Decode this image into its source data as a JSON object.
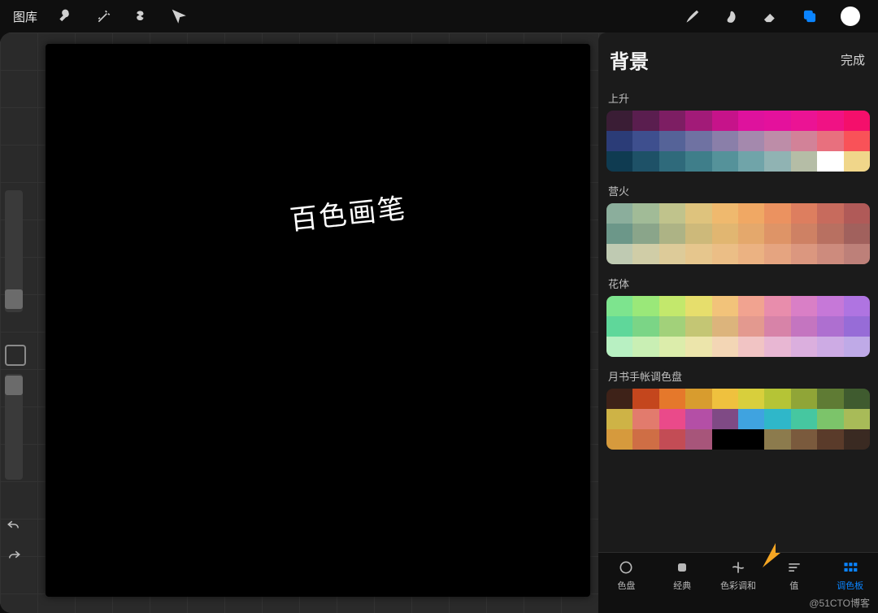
{
  "toolbar": {
    "gallery": "图库"
  },
  "canvas": {
    "text": "百色画笔"
  },
  "panel": {
    "title": "背景",
    "done": "完成",
    "palettes": [
      {
        "name": "上升",
        "colors": [
          "#3a1d35",
          "#5a1e4f",
          "#7d1e63",
          "#a21b78",
          "#c6138a",
          "#de129d",
          "#e4119c",
          "#eb1394",
          "#f01284",
          "#f40f6b",
          "#2b3c77",
          "#3e4f8e",
          "#556398",
          "#6f72a2",
          "#8a7fa9",
          "#a489ad",
          "#bd8da8",
          "#d28298",
          "#e8707e",
          "#f95258",
          "#0f3b51",
          "#1e5167",
          "#2f6a7b",
          "#3f7e8a",
          "#55929a",
          "#70a4a9",
          "#90b3b3",
          "#b5bda6",
          "#ffffff",
          "#f0d68a"
        ]
      },
      {
        "name": "营火",
        "colors": [
          "#8bae9c",
          "#a1bb97",
          "#c0c38c",
          "#dec37d",
          "#efb96e",
          "#f0a864",
          "#eb9260",
          "#dd7e5f",
          "#c76b5d",
          "#b05a58",
          "#6c9789",
          "#8aa58a",
          "#adb385",
          "#cdb97a",
          "#e1b671",
          "#e4a86c",
          "#de9467",
          "#ce8164",
          "#b87061",
          "#a1615d",
          "#bfcab2",
          "#d0cda7",
          "#ddcb99",
          "#e6c68d",
          "#ebbe86",
          "#ebb282",
          "#e5a480",
          "#db977f",
          "#cd8b7d",
          "#bd8079"
        ]
      },
      {
        "name": "花体",
        "colors": [
          "#7de48e",
          "#9ae879",
          "#c3e86c",
          "#e6de6c",
          "#f2c37a",
          "#f1a390",
          "#e88dac",
          "#d97fc6",
          "#c678d8",
          "#af74e1",
          "#5fd79a",
          "#7bd586",
          "#a2d17a",
          "#c4c674",
          "#dcb47c",
          "#e3998f",
          "#d783a8",
          "#c475c0",
          "#ae6fd0",
          "#976cd7",
          "#b8f0c2",
          "#c9efb4",
          "#dcedab",
          "#ece5ab",
          "#f3d6b5",
          "#f1c4c4",
          "#e8b7d3",
          "#dbafde",
          "#cdabe4",
          "#bfaae7"
        ]
      },
      {
        "name": "月书手帐调色盘",
        "colors": [
          "#3e2218",
          "#c4461d",
          "#e5782b",
          "#d89c2e",
          "#efc13e",
          "#d8cf3c",
          "#b5c436",
          "#90a537",
          "#5f7b34",
          "#3f5b2f",
          "#ceb346",
          "#e27b6d",
          "#ea4a8a",
          "#b44fa6",
          "#7f4a85",
          "#3fa3e0",
          "#2fb7c9",
          "#46c7a0",
          "#7cc46a",
          "#a8bb58",
          "#d69a3d",
          "#cf6e45",
          "#c34c55",
          "#a7557a",
          "#000000",
          "#000000",
          "#8c7b4d",
          "#7a5a3d",
          "#5a3b2a",
          "#3a2a22"
        ]
      }
    ],
    "tabs": [
      {
        "id": "disc",
        "label": "色盘"
      },
      {
        "id": "classic",
        "label": "经典"
      },
      {
        "id": "harmony",
        "label": "色彩调和"
      },
      {
        "id": "value",
        "label": "值"
      },
      {
        "id": "palettes",
        "label": "调色板"
      }
    ],
    "active_tab": "palettes"
  },
  "watermark": "@51CTO博客"
}
